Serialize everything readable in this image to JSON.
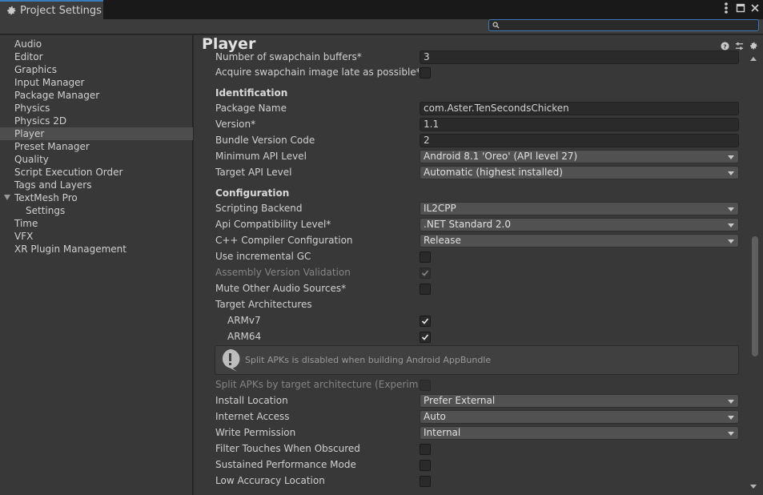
{
  "window": {
    "title": "Project Settings"
  },
  "search": {
    "placeholder": "",
    "value": ""
  },
  "sidebar": {
    "items": [
      {
        "label": "Audio"
      },
      {
        "label": "Editor"
      },
      {
        "label": "Graphics"
      },
      {
        "label": "Input Manager"
      },
      {
        "label": "Package Manager"
      },
      {
        "label": "Physics"
      },
      {
        "label": "Physics 2D"
      },
      {
        "label": "Player",
        "selected": true
      },
      {
        "label": "Preset Manager"
      },
      {
        "label": "Quality"
      },
      {
        "label": "Script Execution Order"
      },
      {
        "label": "Tags and Layers"
      },
      {
        "label": "TextMesh Pro",
        "expanded": true
      },
      {
        "label": "Settings",
        "child": true
      },
      {
        "label": "Time"
      },
      {
        "label": "VFX"
      },
      {
        "label": "XR Plugin Management"
      }
    ]
  },
  "main": {
    "title": "Player",
    "rows": {
      "swapchain": {
        "label": "Number of swapchain buffers*",
        "value": "3"
      },
      "acquire_late": {
        "label": "Acquire swapchain image late as possible*",
        "checked": false
      },
      "identification": "Identification",
      "package_name": {
        "label": "Package Name",
        "value": "com.Aster.TenSecondsChicken"
      },
      "version": {
        "label": "Version*",
        "value": "1.1"
      },
      "bundle_code": {
        "label": "Bundle Version Code",
        "value": "2"
      },
      "min_api": {
        "label": "Minimum API Level",
        "value": "Android 8.1 'Oreo' (API level 27)"
      },
      "target_api": {
        "label": "Target API Level",
        "value": "Automatic (highest installed)"
      },
      "configuration": "Configuration",
      "scripting_backend": {
        "label": "Scripting Backend",
        "value": "IL2CPP"
      },
      "api_compat": {
        "label": "Api Compatibility Level*",
        "value": ".NET Standard 2.0"
      },
      "cpp_config": {
        "label": "C++ Compiler Configuration",
        "value": "Release"
      },
      "incremental_gc": {
        "label": "Use incremental GC",
        "checked": false
      },
      "assembly_validation": {
        "label": "Assembly Version Validation",
        "checked": true
      },
      "mute_audio": {
        "label": "Mute Other Audio Sources*",
        "checked": false
      },
      "target_arch": {
        "label": "Target Architectures"
      },
      "armv7": {
        "label": "ARMv7",
        "checked": true
      },
      "arm64": {
        "label": "ARM64",
        "checked": true
      },
      "help_message": "Split APKs is disabled when building Android AppBundle",
      "split_apks": {
        "label": "Split APKs by target architecture (Experimenta",
        "checked": false
      },
      "install_location": {
        "label": "Install Location",
        "value": "Prefer External"
      },
      "internet_access": {
        "label": "Internet Access",
        "value": "Auto"
      },
      "write_permission": {
        "label": "Write Permission",
        "value": "Internal"
      },
      "filter_touches": {
        "label": "Filter Touches When Obscured",
        "checked": false
      },
      "sustained_perf": {
        "label": "Sustained Performance Mode",
        "checked": false
      },
      "low_accuracy": {
        "label": "Low Accuracy Location",
        "checked": false
      }
    }
  },
  "colors": {
    "accent": "#3a79bb",
    "selected": "#4d4d4d",
    "panel": "#383838"
  }
}
